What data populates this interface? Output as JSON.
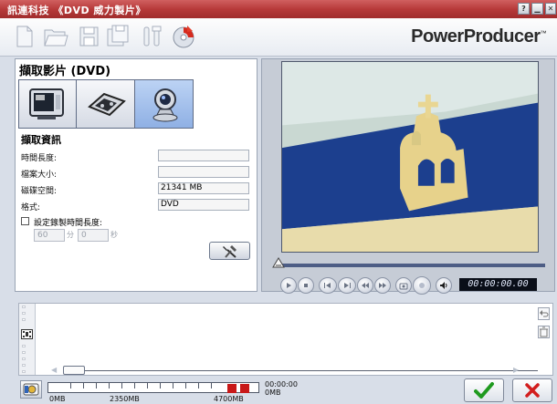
{
  "window": {
    "title": "訊連科技 《DVD 威力製片》",
    "controls": [
      "?",
      "▁",
      "✕"
    ]
  },
  "toolbar": {
    "brand": "PowerProducer",
    "brand_mark": "™",
    "icons": [
      "new-project-icon",
      "open-project-icon",
      "save-icon",
      "save-as-icon",
      "tools-icon",
      "burn-disc-icon"
    ]
  },
  "capture": {
    "title": "擷取影片 (DVD)",
    "sources": [
      {
        "name": "tv-source-icon",
        "active": false
      },
      {
        "name": "dv-camcorder-icon",
        "active": false
      },
      {
        "name": "webcam-icon",
        "active": true
      }
    ],
    "info_title": "擷取資訊",
    "fields": [
      {
        "label": "時間長度:",
        "value": ""
      },
      {
        "label": "檔案大小:",
        "value": ""
      },
      {
        "label": "磁碟空間:",
        "value": "21341 MB"
      },
      {
        "label": "格式:",
        "value": "DVD"
      }
    ],
    "set_duration_label": "設定錄製時間長度:",
    "minutes_value": "60",
    "minutes_unit": "分",
    "seconds_value": "0",
    "seconds_unit": "秒"
  },
  "player": {
    "timecode": "00:00:00.00",
    "buttons": [
      "play-icon",
      "stop-icon",
      "previous-frame-icon",
      "next-frame-icon",
      "rewind-icon",
      "fast-forward-icon",
      "snapshot-icon",
      "record-icon",
      "volume-icon"
    ]
  },
  "disc": {
    "labels": [
      "0MB",
      "2350MB",
      "4700MB"
    ],
    "time": "00:00:00",
    "size": "0MB"
  },
  "colors": {
    "titlebar": "#b73a3a",
    "accent_red": "#c81818",
    "ok_green": "#1f9a1f"
  }
}
